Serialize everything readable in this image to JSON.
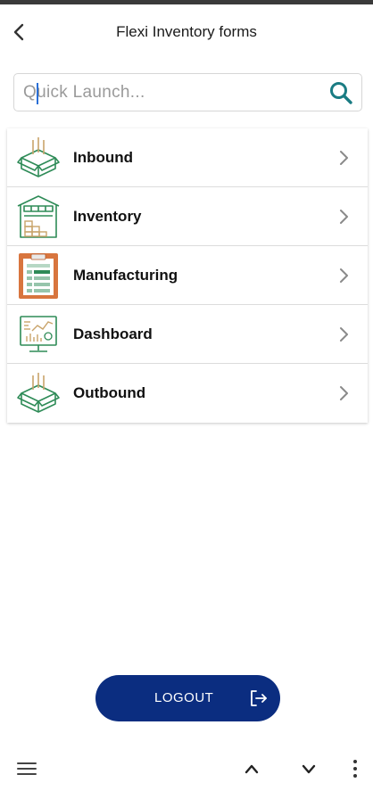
{
  "header": {
    "title": "Flexi Inventory forms",
    "back_icon": "chevron-left-icon"
  },
  "search": {
    "placeholder": "Quick Launch...",
    "value": "",
    "icon": "search-icon",
    "icon_color": "#1a7c83"
  },
  "menu": {
    "items": [
      {
        "label": "Inbound",
        "icon": "open-box-icon"
      },
      {
        "label": "Inventory",
        "icon": "warehouse-icon"
      },
      {
        "label": "Manufacturing",
        "icon": "clipboard-icon"
      },
      {
        "label": "Dashboard",
        "icon": "dashboard-monitor-icon"
      },
      {
        "label": "Outbound",
        "icon": "open-box-icon"
      }
    ],
    "chevron_icon": "chevron-right-icon"
  },
  "logout": {
    "label": "LOGOUT",
    "icon": "logout-icon",
    "color": "#0b2d80"
  },
  "bottom_nav": {
    "icons": [
      "hamburger-menu-icon",
      "chevron-up-icon",
      "chevron-down-icon",
      "more-vertical-icon"
    ]
  },
  "colors": {
    "accent_teal": "#1a7c83",
    "icon_green": "#2e8b57",
    "icon_tan": "#c9a46a",
    "clipboard_orange": "#d8753e"
  }
}
